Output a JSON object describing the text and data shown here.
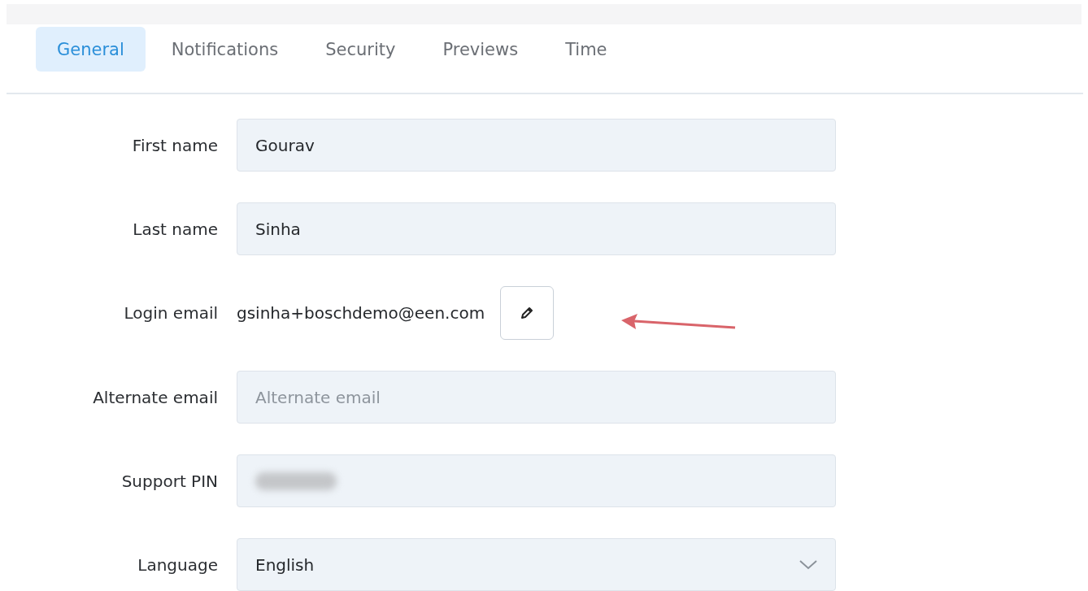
{
  "tabs": [
    {
      "label": "General",
      "selected": true
    },
    {
      "label": "Notifications",
      "selected": false
    },
    {
      "label": "Security",
      "selected": false
    },
    {
      "label": "Previews",
      "selected": false
    },
    {
      "label": "Time",
      "selected": false
    }
  ],
  "fields": [
    {
      "kind": "input",
      "label": "First name",
      "value": "Gourav"
    },
    {
      "kind": "input",
      "label": "Last name",
      "value": "Sinha"
    },
    {
      "kind": "email",
      "label": "Login email",
      "value": "gsinha+boschdemo@een.com"
    },
    {
      "kind": "input",
      "label": "Alternate email",
      "placeholder": "Alternate email"
    },
    {
      "kind": "redacted",
      "label": "Support PIN"
    },
    {
      "kind": "select",
      "label": "Language",
      "value": "English"
    }
  ]
}
